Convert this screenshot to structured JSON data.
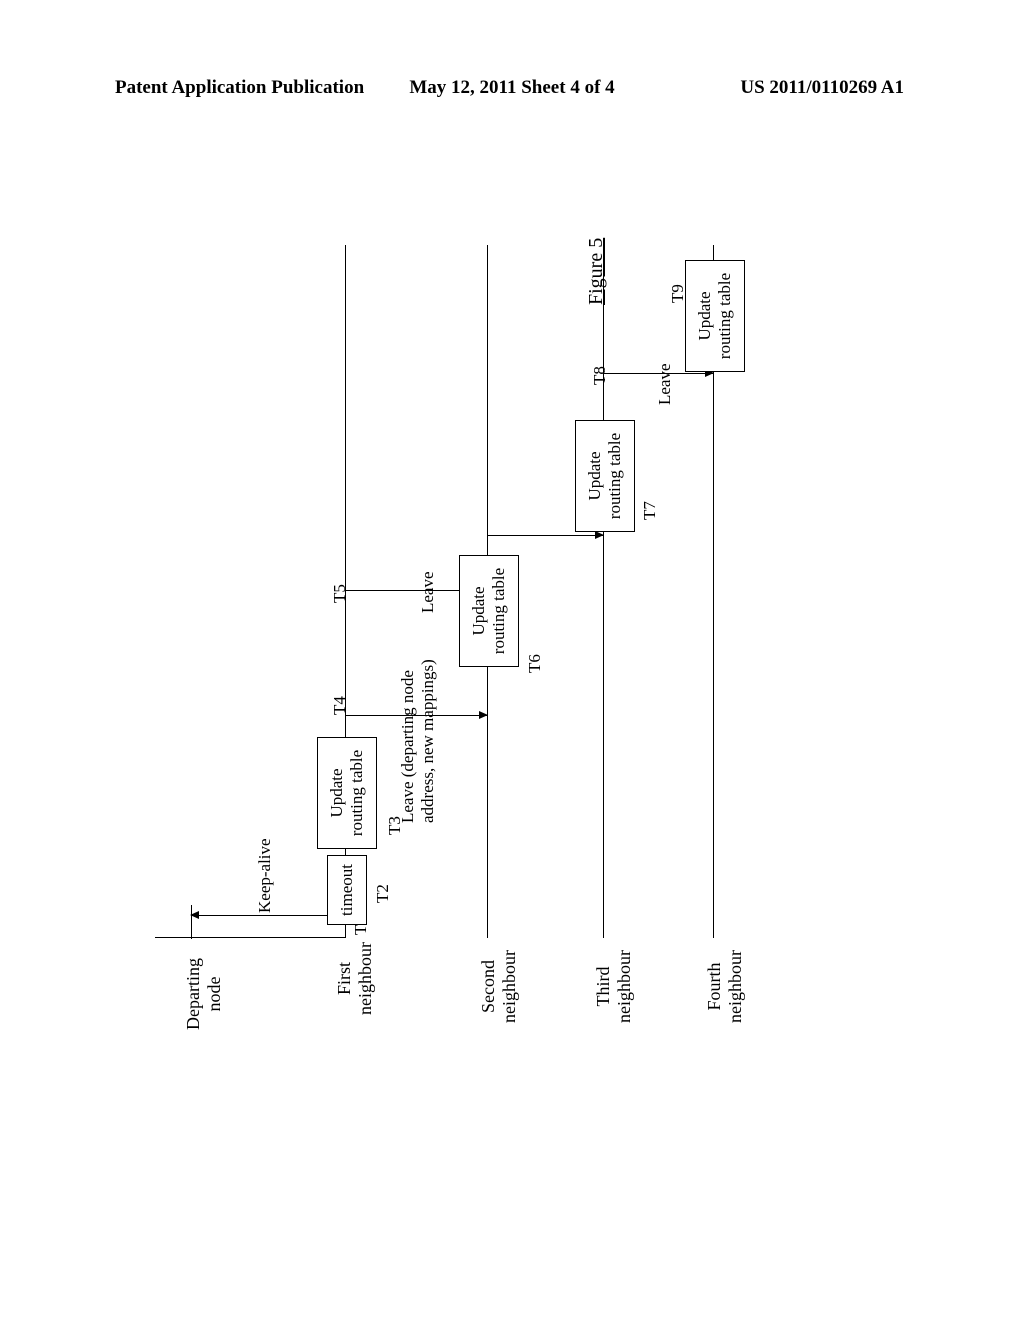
{
  "header": {
    "left": "Patent Application Publication",
    "mid": "May 12, 2011  Sheet 4 of 4",
    "right": "US 2011/0110269 A1"
  },
  "nodes": {
    "departing": "Departing\nnode",
    "n1": "First\nneighbour",
    "n2": "Second\nneighbour",
    "n3": "Third\nneighbour",
    "n4": "Fourth\nneighbour"
  },
  "messages": {
    "keep_alive": "Keep-alive",
    "leave_full": "Leave (departing node\naddress, new mappings)",
    "leave": "Leave"
  },
  "boxes": {
    "timeout": "timeout",
    "update": "Update\nrouting table"
  },
  "time": {
    "t1": "T1",
    "t2": "T2",
    "t3": "T3",
    "t4": "T4",
    "t5": "T5",
    "t6": "T6",
    "t7": "T7",
    "t8": "T8",
    "t9": "T9"
  },
  "figure": "Figure 5",
  "chart_data": {
    "type": "sequence-diagram",
    "title": "Figure 5",
    "participants": [
      "Departing node",
      "First neighbour",
      "Second neighbour",
      "Third neighbour",
      "Fourth neighbour"
    ],
    "events": [
      {
        "t": "T1",
        "from": "First neighbour",
        "to": "Departing node",
        "label": "Keep-alive"
      },
      {
        "t": "T2",
        "at": "First neighbour",
        "action": "timeout"
      },
      {
        "t": "T3",
        "at": "First neighbour",
        "action": "Update routing table"
      },
      {
        "t": "T4",
        "from": "First neighbour",
        "to": "Second neighbour",
        "label": "Leave (departing node address, new mappings)"
      },
      {
        "t": "T5",
        "from": "First neighbour",
        "to": "Second neighbour",
        "label": "Leave"
      },
      {
        "t": "T6",
        "at": "Second neighbour",
        "action": "Update routing table"
      },
      {
        "t": null,
        "from": "Second neighbour",
        "to": "Third neighbour",
        "label": "Leave"
      },
      {
        "t": "T7",
        "at": "Third neighbour",
        "action": "Update routing table"
      },
      {
        "t": "T8",
        "from": "Third neighbour",
        "to": "Fourth neighbour",
        "label": "Leave"
      },
      {
        "t": "T9",
        "at": "Fourth neighbour",
        "action": "Update routing table"
      }
    ]
  }
}
